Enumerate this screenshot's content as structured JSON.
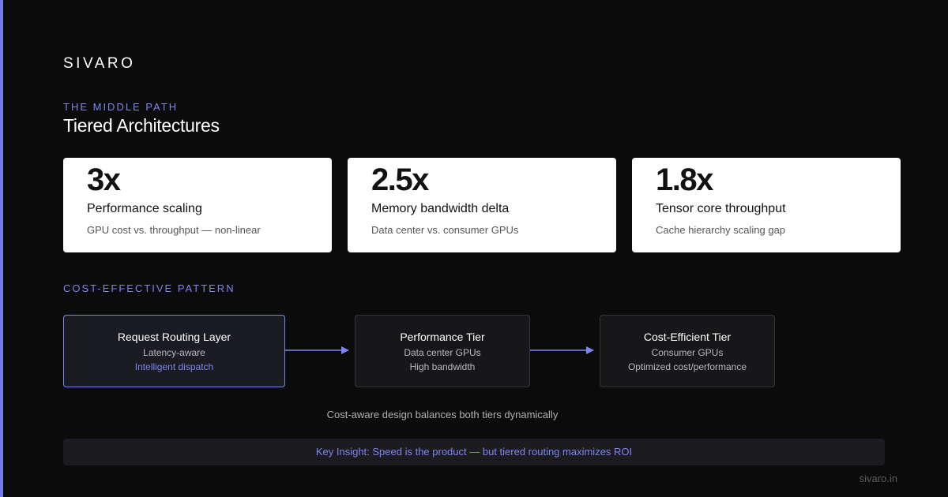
{
  "brand": "SIVARO",
  "section_eyebrow": "THE MIDDLE PATH",
  "title": "Tiered Architectures",
  "stats": [
    {
      "value": "3x",
      "label": "Performance scaling",
      "desc": "GPU cost vs. throughput — non-linear"
    },
    {
      "value": "2.5x",
      "label": "Memory bandwidth delta",
      "desc": "Data center vs. consumer GPUs"
    },
    {
      "value": "1.8x",
      "label": "Tensor core throughput",
      "desc": "Cache hierarchy scaling gap"
    }
  ],
  "pattern_eyebrow": "COST-EFFECTIVE PATTERN",
  "nodes": [
    {
      "title": "Request Routing Layer",
      "line1": "Latency-aware",
      "line2": "Intelligent dispatch"
    },
    {
      "title": "Performance Tier",
      "line1": "Data center GPUs",
      "line2": "High bandwidth"
    },
    {
      "title": "Cost-Efficient Tier",
      "line1": "Consumer GPUs",
      "line2": "Optimized cost/performance"
    }
  ],
  "caption": "Cost-aware design balances both tiers dynamically",
  "insight": "Key Insight: Speed is the product — but tiered routing maximizes ROI",
  "footer": "sivaro.in",
  "colors": {
    "accent": "#7c86f0",
    "background": "#0b0b0c",
    "card": "#ffffff"
  }
}
